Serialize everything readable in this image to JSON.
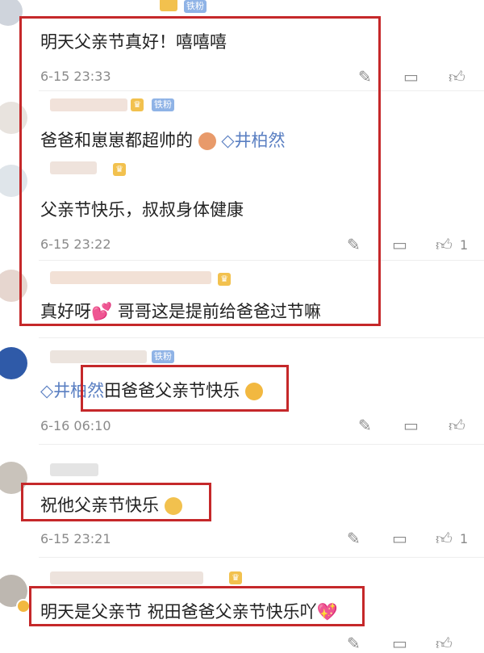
{
  "comments": [
    {
      "text": "明天父亲节真好！嘻嘻嘻",
      "time": "6-15 23:33",
      "badge": "铁粉"
    },
    {
      "text": "爸爸和崽崽都超帅的",
      "tag": "井柏然",
      "badge": "铁粉"
    },
    {
      "text": "父亲节快乐，叔叔身体健康",
      "time": "6-15 23:22",
      "like_count": "1"
    },
    {
      "text": "真好呀",
      "text_after": " 哥哥这是提前给爸爸过节嘛"
    },
    {
      "tag": "井柏然",
      "text": "田爸爸父亲节快乐",
      "time": "6-16 06:10",
      "badge": "铁粉"
    },
    {
      "text": "祝他父亲节快乐",
      "time": "6-15 23:21",
      "like_count": "1"
    },
    {
      "text": "明天是父亲节 祝田爸爸父亲节快乐吖"
    }
  ],
  "icons": {
    "comment": "comment-icon",
    "repost": "repost-icon",
    "like": "like-icon",
    "diamond": "diamond-icon"
  },
  "colors": {
    "highlight_box": "#c5282a",
    "tag": "#5a7fc2",
    "meta": "#8a8a8a"
  }
}
